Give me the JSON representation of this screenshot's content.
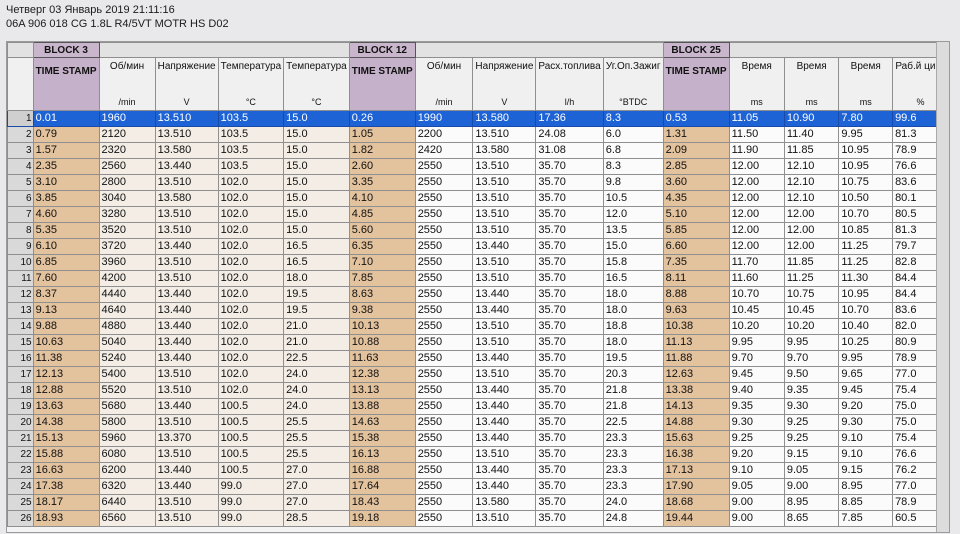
{
  "header": {
    "line1": "Четверг 03 Январь 2019 21:11:16",
    "line2": "06A 906 018 CG  1.8L R4/5VT MOTR HS D02"
  },
  "blocks": [
    "BLOCK 3",
    "BLOCK 12",
    "BLOCK 25"
  ],
  "columns": [
    {
      "label": "TIME STAMP",
      "unit": ""
    },
    {
      "label": "Об/мин",
      "unit": "/min"
    },
    {
      "label": "Напряжение",
      "unit": "V"
    },
    {
      "label": "Температура",
      "unit": "°C"
    },
    {
      "label": "Температура",
      "unit": "°C"
    },
    {
      "label": "TIME STAMP",
      "unit": ""
    },
    {
      "label": "Об/мин",
      "unit": "/min"
    },
    {
      "label": "Напряжение",
      "unit": "V"
    },
    {
      "label": "Расх.топлива",
      "unit": "l/h"
    },
    {
      "label": "Уг.Оп.Зажиг",
      "unit": "°BTDC"
    },
    {
      "label": "TIME STAMP",
      "unit": ""
    },
    {
      "label": "Время",
      "unit": "ms"
    },
    {
      "label": "Время",
      "unit": "ms"
    },
    {
      "label": "Время",
      "unit": "ms"
    },
    {
      "label": "Раб.й цикл",
      "unit": "%"
    }
  ],
  "rows": [
    [
      "1",
      "0.01",
      "1960",
      "13.510",
      "103.5",
      "15.0",
      "0.26",
      "1990",
      "13.580",
      "17.36",
      "8.3",
      "0.53",
      "11.05",
      "10.90",
      "7.80",
      "99.6"
    ],
    [
      "2",
      "0.79",
      "2120",
      "13.510",
      "103.5",
      "15.0",
      "1.05",
      "2200",
      "13.510",
      "24.08",
      "6.0",
      "1.31",
      "11.50",
      "11.40",
      "9.95",
      "81.3"
    ],
    [
      "3",
      "1.57",
      "2320",
      "13.580",
      "103.5",
      "15.0",
      "1.82",
      "2420",
      "13.580",
      "31.08",
      "6.8",
      "2.09",
      "11.90",
      "11.85",
      "10.95",
      "78.9"
    ],
    [
      "4",
      "2.35",
      "2560",
      "13.440",
      "103.5",
      "15.0",
      "2.60",
      "2550",
      "13.510",
      "35.70",
      "8.3",
      "2.85",
      "12.00",
      "12.10",
      "10.95",
      "76.6"
    ],
    [
      "5",
      "3.10",
      "2800",
      "13.510",
      "102.0",
      "15.0",
      "3.35",
      "2550",
      "13.510",
      "35.70",
      "9.8",
      "3.60",
      "12.00",
      "12.10",
      "10.75",
      "83.6"
    ],
    [
      "6",
      "3.85",
      "3040",
      "13.580",
      "102.0",
      "15.0",
      "4.10",
      "2550",
      "13.510",
      "35.70",
      "10.5",
      "4.35",
      "12.00",
      "12.10",
      "10.50",
      "80.1"
    ],
    [
      "7",
      "4.60",
      "3280",
      "13.510",
      "102.0",
      "15.0",
      "4.85",
      "2550",
      "13.510",
      "35.70",
      "12.0",
      "5.10",
      "12.00",
      "12.00",
      "10.70",
      "80.5"
    ],
    [
      "8",
      "5.35",
      "3520",
      "13.510",
      "102.0",
      "15.0",
      "5.60",
      "2550",
      "13.510",
      "35.70",
      "13.5",
      "5.85",
      "12.00",
      "12.00",
      "10.85",
      "81.3"
    ],
    [
      "9",
      "6.10",
      "3720",
      "13.440",
      "102.0",
      "16.5",
      "6.35",
      "2550",
      "13.440",
      "35.70",
      "15.0",
      "6.60",
      "12.00",
      "12.00",
      "11.25",
      "79.7"
    ],
    [
      "10",
      "6.85",
      "3960",
      "13.510",
      "102.0",
      "16.5",
      "7.10",
      "2550",
      "13.510",
      "35.70",
      "15.8",
      "7.35",
      "11.70",
      "11.85",
      "11.25",
      "82.8"
    ],
    [
      "11",
      "7.60",
      "4200",
      "13.510",
      "102.0",
      "18.0",
      "7.85",
      "2550",
      "13.510",
      "35.70",
      "16.5",
      "8.11",
      "11.60",
      "11.25",
      "11.30",
      "84.4"
    ],
    [
      "12",
      "8.37",
      "4440",
      "13.440",
      "102.0",
      "19.5",
      "8.63",
      "2550",
      "13.440",
      "35.70",
      "18.0",
      "8.88",
      "10.70",
      "10.75",
      "10.95",
      "84.4"
    ],
    [
      "13",
      "9.13",
      "4640",
      "13.440",
      "102.0",
      "19.5",
      "9.38",
      "2550",
      "13.440",
      "35.70",
      "18.0",
      "9.63",
      "10.45",
      "10.45",
      "10.70",
      "83.6"
    ],
    [
      "14",
      "9.88",
      "4880",
      "13.440",
      "102.0",
      "21.0",
      "10.13",
      "2550",
      "13.510",
      "35.70",
      "18.8",
      "10.38",
      "10.20",
      "10.20",
      "10.40",
      "82.0"
    ],
    [
      "15",
      "10.63",
      "5040",
      "13.440",
      "102.0",
      "21.0",
      "10.88",
      "2550",
      "13.510",
      "35.70",
      "18.0",
      "11.13",
      "9.95",
      "9.95",
      "10.25",
      "80.9"
    ],
    [
      "16",
      "11.38",
      "5240",
      "13.440",
      "102.0",
      "22.5",
      "11.63",
      "2550",
      "13.440",
      "35.70",
      "19.5",
      "11.88",
      "9.70",
      "9.70",
      "9.95",
      "78.9"
    ],
    [
      "17",
      "12.13",
      "5400",
      "13.510",
      "102.0",
      "24.0",
      "12.38",
      "2550",
      "13.510",
      "35.70",
      "20.3",
      "12.63",
      "9.45",
      "9.50",
      "9.65",
      "77.0"
    ],
    [
      "18",
      "12.88",
      "5520",
      "13.510",
      "102.0",
      "24.0",
      "13.13",
      "2550",
      "13.440",
      "35.70",
      "21.8",
      "13.38",
      "9.40",
      "9.35",
      "9.45",
      "75.4"
    ],
    [
      "19",
      "13.63",
      "5680",
      "13.440",
      "100.5",
      "24.0",
      "13.88",
      "2550",
      "13.440",
      "35.70",
      "21.8",
      "14.13",
      "9.35",
      "9.30",
      "9.20",
      "75.0"
    ],
    [
      "20",
      "14.38",
      "5800",
      "13.510",
      "100.5",
      "25.5",
      "14.63",
      "2550",
      "13.440",
      "35.70",
      "22.5",
      "14.88",
      "9.30",
      "9.25",
      "9.30",
      "75.0"
    ],
    [
      "21",
      "15.13",
      "5960",
      "13.370",
      "100.5",
      "25.5",
      "15.38",
      "2550",
      "13.440",
      "35.70",
      "23.3",
      "15.63",
      "9.25",
      "9.25",
      "9.10",
      "75.4"
    ],
    [
      "22",
      "15.88",
      "6080",
      "13.510",
      "100.5",
      "25.5",
      "16.13",
      "2550",
      "13.510",
      "35.70",
      "23.3",
      "16.38",
      "9.20",
      "9.15",
      "9.10",
      "76.6"
    ],
    [
      "23",
      "16.63",
      "6200",
      "13.440",
      "100.5",
      "27.0",
      "16.88",
      "2550",
      "13.440",
      "35.70",
      "23.3",
      "17.13",
      "9.10",
      "9.05",
      "9.15",
      "76.2"
    ],
    [
      "24",
      "17.38",
      "6320",
      "13.440",
      "99.0",
      "27.0",
      "17.64",
      "2550",
      "13.440",
      "35.70",
      "23.3",
      "17.90",
      "9.05",
      "9.00",
      "8.95",
      "77.0"
    ],
    [
      "25",
      "18.17",
      "6440",
      "13.510",
      "99.0",
      "27.0",
      "18.43",
      "2550",
      "13.580",
      "35.70",
      "24.0",
      "18.68",
      "9.00",
      "8.95",
      "8.85",
      "78.9"
    ],
    [
      "26",
      "18.93",
      "6560",
      "13.510",
      "99.0",
      "28.5",
      "19.18",
      "2550",
      "13.510",
      "35.70",
      "24.8",
      "19.44",
      "9.00",
      "8.65",
      "7.85",
      "60.5"
    ]
  ]
}
